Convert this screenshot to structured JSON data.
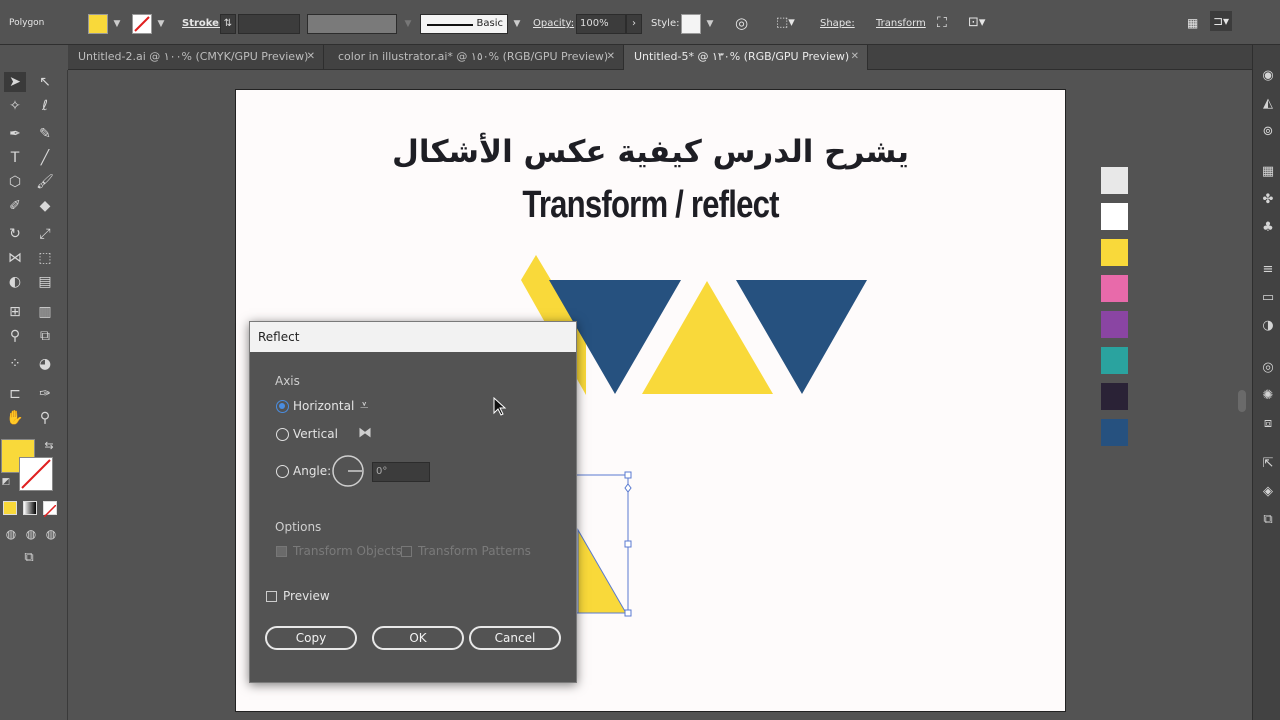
{
  "control_bar": {
    "selection_label": "Polygon",
    "fill_color": "#f9d93a",
    "stroke_label": "Stroke:",
    "brush_label": "Basic",
    "opacity_label": "Opacity:",
    "opacity_value": "100%",
    "style_label": "Style:",
    "shape_label": "Shape:",
    "transform_label": "Transform"
  },
  "tabs": [
    {
      "label": "Untitled-2.ai @ ١٠٠% (CMYK/GPU Preview)"
    },
    {
      "label": "color in illustrator.ai* @ ١٥٠% (RGB/GPU Preview)"
    },
    {
      "label": "Untitled-5* @ ١٣٠% (RGB/GPU Preview)"
    }
  ],
  "artboard": {
    "arabic_title": "يشرح الدرس كيفية عكس الأشكال",
    "english_title": "Transform / reflect"
  },
  "palette": [
    "#e8e8e8",
    "#ffffff",
    "#f9d93a",
    "#e86aaa",
    "#8a45a3",
    "#2aa39f",
    "#2a2236",
    "#26517f"
  ],
  "colors": {
    "yellow": "#f9d93a",
    "blue": "#26517f"
  },
  "dialog": {
    "title": "Reflect",
    "axis_label": "Axis",
    "horizontal_label": "Horizontal",
    "vertical_label": "Vertical",
    "angle_label": "Angle:",
    "angle_value": "0°",
    "options_label": "Options",
    "transform_objects_label": "Transform Objects",
    "transform_patterns_label": "Transform Patterns",
    "preview_label": "Preview",
    "copy_label": "Copy",
    "ok_label": "OK",
    "cancel_label": "Cancel",
    "selected_axis": "Horizontal"
  }
}
